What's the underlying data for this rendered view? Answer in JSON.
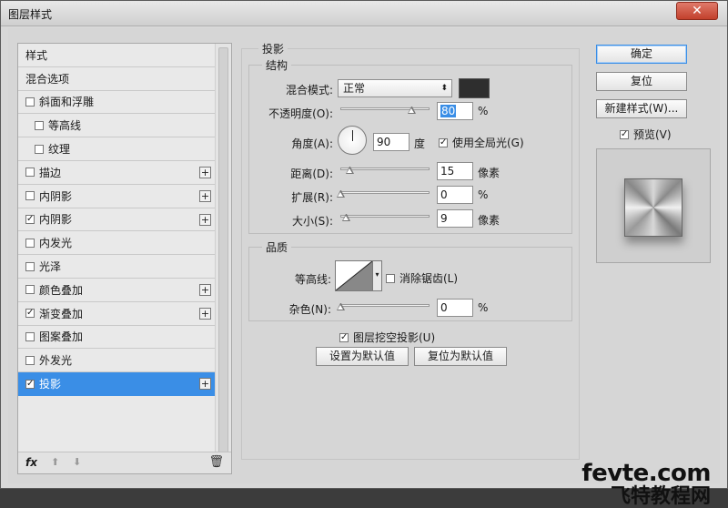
{
  "window": {
    "title": "图层样式",
    "close_glyph": "✕"
  },
  "left_panel": {
    "items": [
      {
        "label": "样式",
        "has_checkbox": false,
        "checked": false,
        "has_plus": false,
        "sub": false,
        "active": false
      },
      {
        "label": "混合选项",
        "has_checkbox": false,
        "checked": false,
        "has_plus": false,
        "sub": false,
        "active": false
      },
      {
        "label": "斜面和浮雕",
        "has_checkbox": true,
        "checked": false,
        "has_plus": false,
        "sub": false,
        "active": false
      },
      {
        "label": "等高线",
        "has_checkbox": true,
        "checked": false,
        "has_plus": false,
        "sub": true,
        "active": false
      },
      {
        "label": "纹理",
        "has_checkbox": true,
        "checked": false,
        "has_plus": false,
        "sub": true,
        "active": false
      },
      {
        "label": "描边",
        "has_checkbox": true,
        "checked": false,
        "has_plus": true,
        "sub": false,
        "active": false
      },
      {
        "label": "内阴影",
        "has_checkbox": true,
        "checked": false,
        "has_plus": true,
        "sub": false,
        "active": false
      },
      {
        "label": "内阴影",
        "has_checkbox": true,
        "checked": true,
        "has_plus": true,
        "sub": false,
        "active": false
      },
      {
        "label": "内发光",
        "has_checkbox": true,
        "checked": false,
        "has_plus": false,
        "sub": false,
        "active": false
      },
      {
        "label": "光泽",
        "has_checkbox": true,
        "checked": false,
        "has_plus": false,
        "sub": false,
        "active": false
      },
      {
        "label": "颜色叠加",
        "has_checkbox": true,
        "checked": false,
        "has_plus": true,
        "sub": false,
        "active": false
      },
      {
        "label": "渐变叠加",
        "has_checkbox": true,
        "checked": true,
        "has_plus": true,
        "sub": false,
        "active": false
      },
      {
        "label": "图案叠加",
        "has_checkbox": true,
        "checked": false,
        "has_plus": false,
        "sub": false,
        "active": false
      },
      {
        "label": "外发光",
        "has_checkbox": true,
        "checked": false,
        "has_plus": false,
        "sub": false,
        "active": false
      },
      {
        "label": "投影",
        "has_checkbox": true,
        "checked": true,
        "has_plus": true,
        "sub": false,
        "active": true
      }
    ],
    "bottom": {
      "fx_label": "fx",
      "up_glyph": "⬆",
      "down_glyph": "⬇",
      "trash_glyph": "🗑"
    }
  },
  "drop_shadow": {
    "section_title": "投影",
    "structure": {
      "title": "结构",
      "blend_mode_label": "混合模式:",
      "blend_mode_value": "正常",
      "blend_color": "#2e2e2e",
      "opacity_label": "不透明度(O):",
      "opacity_value": "80",
      "opacity_unit": "%",
      "opacity_fraction": 0.8,
      "angle_label": "角度(A):",
      "angle_value": "90",
      "angle_unit": "度",
      "global_light_label": "使用全局光(G)",
      "global_light_checked": true,
      "distance_label": "距离(D):",
      "distance_value": "15",
      "distance_unit": "像素",
      "distance_fraction": 0.1,
      "spread_label": "扩展(R):",
      "spread_value": "0",
      "spread_unit": "%",
      "spread_fraction": 0.0,
      "size_label": "大小(S):",
      "size_value": "9",
      "size_unit": "像素",
      "size_fraction": 0.06
    },
    "quality": {
      "title": "品质",
      "contour_label": "等高线:",
      "anti_alias_label": "消除锯齿(L)",
      "anti_alias_checked": false,
      "noise_label": "杂色(N):",
      "noise_value": "0",
      "noise_unit": "%",
      "noise_fraction": 0.0
    },
    "knockout_label": "图层挖空投影(U)",
    "knockout_checked": true,
    "make_default_label": "设置为默认值",
    "reset_default_label": "复位为默认值"
  },
  "right_panel": {
    "ok_label": "确定",
    "reset_label": "复位",
    "new_style_label": "新建样式(W)...",
    "preview_label": "预览(V)",
    "preview_checked": true
  },
  "watermark": {
    "line1": "fevte.com",
    "line2": "飞特教程网"
  }
}
